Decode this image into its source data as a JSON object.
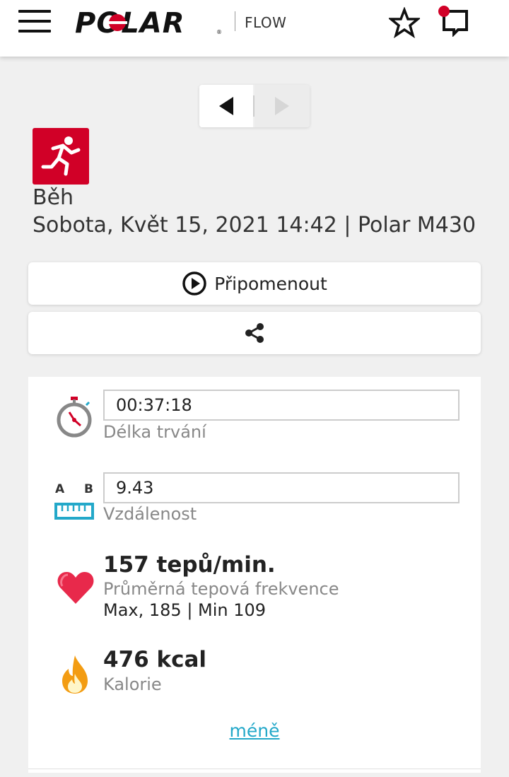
{
  "header": {
    "logo_text": "POLAR",
    "logo_reg": "®",
    "product": "FLOW",
    "menu_icon": "hamburger-menu-icon",
    "favorite_icon": "star-icon",
    "messages_icon": "message-icon",
    "brand_color": "#d10027"
  },
  "navigation": {
    "prev_icon": "triangle-left-icon",
    "next_icon": "triangle-right-icon",
    "next_disabled": true
  },
  "session": {
    "sport_icon": "running-icon",
    "sport_name": "Běh",
    "meta": "Sobota, Květ 15, 2021 14:42 | Polar M430"
  },
  "actions": {
    "replay_label": "Připomenout",
    "replay_icon": "play-circle-icon",
    "share_icon": "share-icon"
  },
  "stats": {
    "duration": {
      "value": "00:37:18",
      "label": "Délka trvání",
      "icon": "stopwatch-icon"
    },
    "distance": {
      "value": "9.43",
      "label": "Vzdálenost",
      "icon": "ruler-icon",
      "icon_letter_a": "A",
      "icon_letter_b": "B"
    },
    "heart_rate": {
      "value": "157 tepů/min.",
      "label": "Průměrná tepová frekvence",
      "sub": "Max, 185  |  Min 109",
      "icon": "heart-icon"
    },
    "calories": {
      "value": "476 kcal",
      "label": "Kalorie",
      "icon": "flame-icon"
    }
  },
  "less_link": "méně",
  "accent_color": "#23a8c9"
}
